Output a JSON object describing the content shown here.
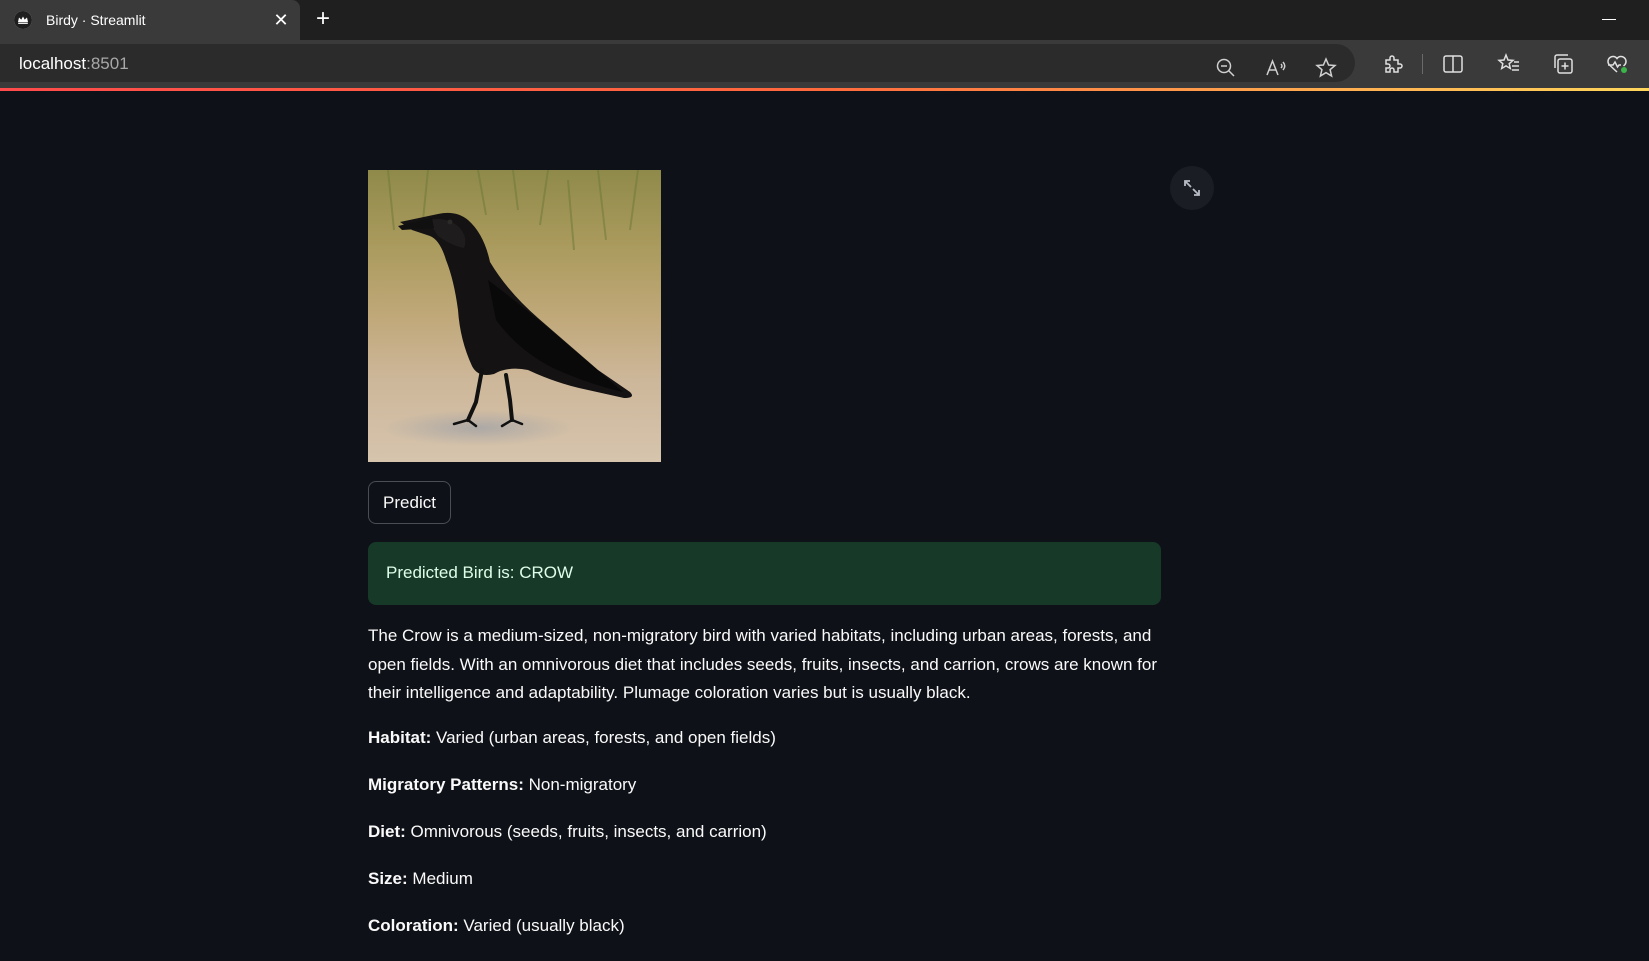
{
  "browser": {
    "tab": {
      "title": "Birdy · Streamlit",
      "close_glyph": "✕",
      "favicon": "streamlit-crown-icon"
    },
    "new_tab_glyph": "+",
    "address": {
      "host": "localhost",
      "port": ":8501"
    },
    "toolbar_icons": [
      "zoom-out-icon",
      "read-aloud-icon",
      "favorite-star-icon",
      "extensions-icon",
      "split-screen-icon",
      "favorites-list-icon",
      "collections-icon",
      "browser-essentials-icon"
    ]
  },
  "app": {
    "image": {
      "subject": "crow",
      "icon": "crow-photo"
    },
    "predict_label": "Predict",
    "result_text": "Predicted Bird is: CROW",
    "description": "The Crow is a medium-sized, non-migratory bird with varied habitats, including urban areas, forests, and open fields. With an omnivorous diet that includes seeds, fruits, insects, and carrion, crows are known for their intelligence and adaptability. Plumage coloration varies but is usually black.",
    "attributes": [
      {
        "label": "Habitat:",
        "value": "Varied (urban areas, forests, and open fields)"
      },
      {
        "label": "Migratory Patterns:",
        "value": "Non-migratory"
      },
      {
        "label": "Diet:",
        "value": "Omnivorous (seeds, fruits, insects, and carrion)"
      },
      {
        "label": "Size:",
        "value": "Medium"
      },
      {
        "label": "Coloration:",
        "value": "Varied (usually black)"
      }
    ]
  },
  "colors": {
    "app_background": "#0e1117",
    "success_background": "#173928",
    "success_text": "#dffde9",
    "accent_gradient": [
      "#ff4b4b",
      "#ffd65c"
    ]
  }
}
